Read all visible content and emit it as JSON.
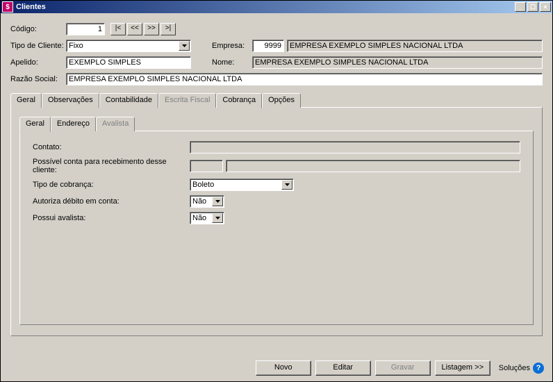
{
  "window": {
    "title": "Clientes",
    "icon_glyph": "$"
  },
  "winbtns": {
    "min": "_",
    "max": "☐",
    "close": "×"
  },
  "header": {
    "codigo_label": "Código:",
    "codigo_value": "1",
    "nav": {
      "first": "|<",
      "prev": "<<",
      "next": ">>",
      "last": ">|"
    },
    "tipo_cliente_label": "Tipo de Cliente:",
    "tipo_cliente_value": "Fixo",
    "empresa_label": "Empresa:",
    "empresa_code": "9999",
    "empresa_name": "EMPRESA EXEMPLO SIMPLES NACIONAL LTDA",
    "apelido_label": "Apelido:",
    "apelido_value": "EXEMPLO SIMPLES",
    "nome_label": "Nome:",
    "nome_value": "EMPRESA EXEMPLO SIMPLES NACIONAL LTDA",
    "razao_label": "Razão Social:",
    "razao_value": "EMPRESA EXEMPLO SIMPLES NACIONAL LTDA"
  },
  "outer_tabs": {
    "geral": "Geral",
    "observacoes": "Observações",
    "contabilidade": "Contabilidade",
    "escrita_fiscal": "Escrita Fiscal",
    "cobranca": "Cobrança",
    "opcoes": "Opções"
  },
  "inner_tabs": {
    "geral": "Geral",
    "endereco": "Endereço",
    "avalista": "Avalista"
  },
  "cobranca": {
    "contato_label": "Contato:",
    "contato_value": "",
    "conta_label": "Possível conta para recebimento desse cliente:",
    "conta_code": "",
    "conta_desc": "",
    "tipo_label": "Tipo de cobrança:",
    "tipo_value": "Boleto",
    "autoriza_label": "Autoriza débito em conta:",
    "autoriza_value": "Não",
    "avalista_label": "Possui avalista:",
    "avalista_value": "Não"
  },
  "footer": {
    "novo": "Novo",
    "editar": "Editar",
    "gravar": "Gravar",
    "listagem": "Listagem >>",
    "solucoes": "Soluções"
  }
}
